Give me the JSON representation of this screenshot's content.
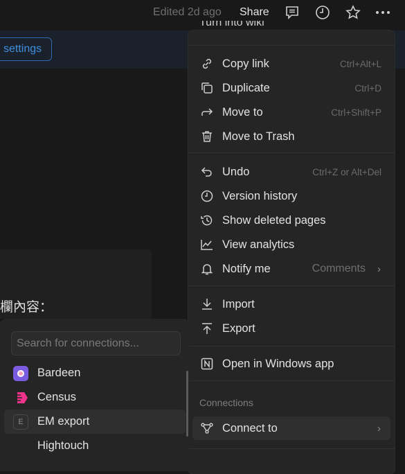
{
  "topbar": {
    "edited": "Edited 2d ago",
    "share": "Share",
    "icons": [
      "comment-icon",
      "clock-icon",
      "star-icon",
      "more-icon"
    ]
  },
  "banner": {
    "settings_label": "settings"
  },
  "page": {
    "cjk_text": "欄內容："
  },
  "menu": {
    "partial_item": "Turn into wiki",
    "group1": [
      {
        "label": "Copy link",
        "shortcut": "Ctrl+Alt+L",
        "icon": "link-icon"
      },
      {
        "label": "Duplicate",
        "shortcut": "Ctrl+D",
        "icon": "duplicate-icon"
      },
      {
        "label": "Move to",
        "shortcut": "Ctrl+Shift+P",
        "icon": "arrow-right-icon"
      },
      {
        "label": "Move to Trash",
        "icon": "trash-icon"
      }
    ],
    "group2": [
      {
        "label": "Undo",
        "shortcut": "Ctrl+Z or Alt+Del",
        "icon": "undo-icon"
      },
      {
        "label": "Version history",
        "icon": "clock-icon"
      },
      {
        "label": "Show deleted pages",
        "icon": "history-icon"
      },
      {
        "label": "View analytics",
        "icon": "chart-icon"
      },
      {
        "label": "Notify me",
        "value": "Comments",
        "icon": "bell-icon"
      }
    ],
    "group3": [
      {
        "label": "Import",
        "icon": "import-icon"
      },
      {
        "label": "Export",
        "icon": "export-icon"
      }
    ],
    "open_app": {
      "label": "Open in Windows app",
      "icon": "notion-icon"
    },
    "connections_label": "Connections",
    "connect_to": {
      "label": "Connect to",
      "icon": "connections-icon"
    }
  },
  "connections_popup": {
    "search_placeholder": "Search for connections...",
    "items": [
      {
        "label": "Bardeen",
        "color": "#7b5be0"
      },
      {
        "label": "Census",
        "color": "#f0338a"
      },
      {
        "label": "EM export",
        "letter": "E"
      },
      {
        "label": "Hightouch"
      }
    ]
  }
}
